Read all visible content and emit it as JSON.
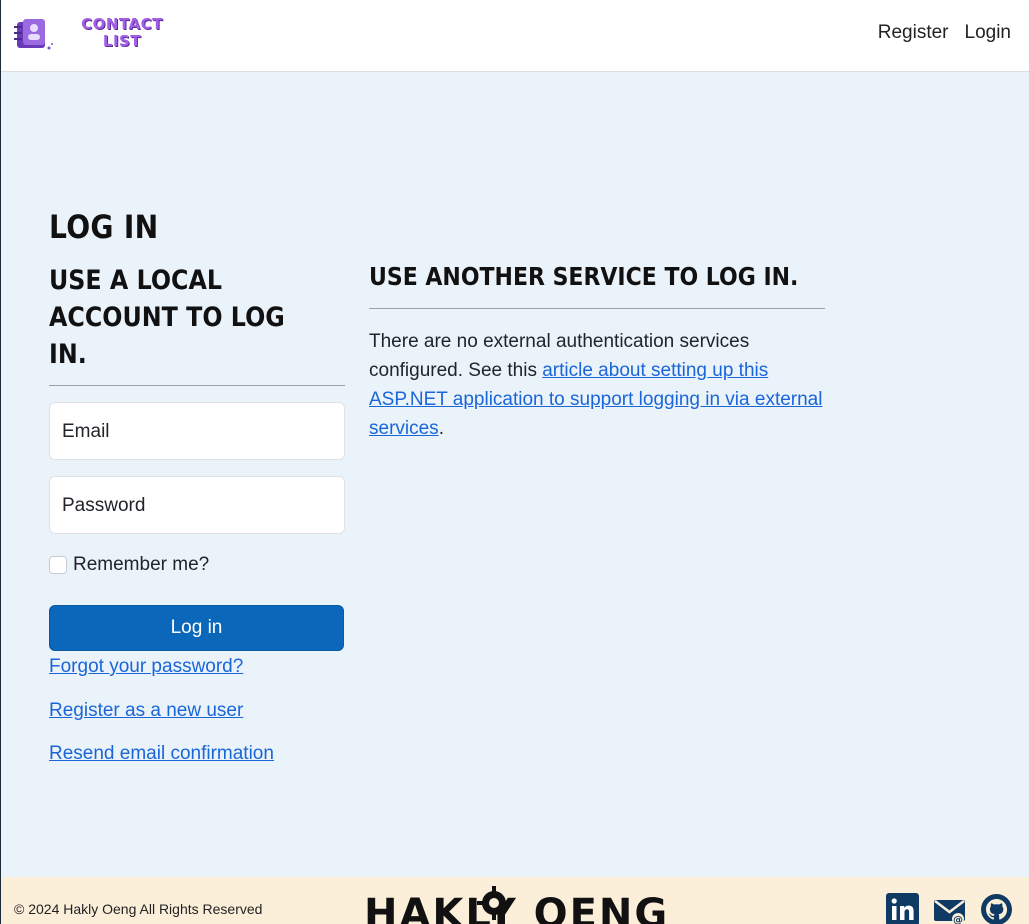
{
  "header": {
    "brand_line1": "CONTACT",
    "brand_line2": "LIST",
    "nav": {
      "register": "Register",
      "login": "Login"
    }
  },
  "page": {
    "title": "LOG IN",
    "local": {
      "heading": "USE A LOCAL\nACCOUNT TO LOG IN.",
      "email_placeholder": "Email",
      "password_placeholder": "Password",
      "remember_label": "Remember me?",
      "login_button": "Log in",
      "forgot_link": "Forgot your password?",
      "register_link": "Register as a new user",
      "resend_link": "Resend email confirmation"
    },
    "external": {
      "heading": "USE ANOTHER SERVICE TO LOG IN.",
      "text_before": "There are no external authentication services configured. See this ",
      "link_text": "article about setting up this ASP.NET application to support logging in via external services",
      "text_after": "."
    }
  },
  "footer": {
    "copyright": "© 2024 Hakly Oeng All Rights Reserved",
    "logo_text": "HAKLY OENG",
    "icons": [
      "linkedin-icon",
      "email-icon",
      "github-icon"
    ]
  },
  "colors": {
    "primary": "#0a67b9",
    "link": "#1a66d9",
    "background": "#eaf2fa",
    "footer_bg": "#fcefd9",
    "brand": "#a25fe6"
  }
}
